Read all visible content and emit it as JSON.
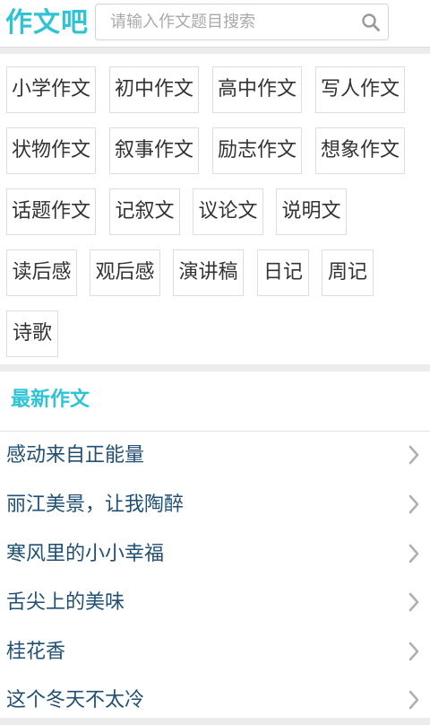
{
  "app": {
    "logo": "作文吧",
    "accent_color": "#2ec4d6"
  },
  "search": {
    "placeholder": "请输入作文题目搜索",
    "value": "",
    "icon": "search-icon"
  },
  "categories": [
    "小学作文",
    "初中作文",
    "高中作文",
    "写人作文",
    "状物作文",
    "叙事作文",
    "励志作文",
    "想象作文",
    "话题作文",
    "记叙文",
    "议论文",
    "说明文",
    "读后感",
    "观后感",
    "演讲稿",
    "日记",
    "周记",
    "诗歌"
  ],
  "latest": {
    "title": "最新作文",
    "articles": [
      "感动来自正能量",
      "丽江美景，让我陶醉",
      "寒风里的小小幸福",
      "舌尖上的美味",
      "桂花香",
      "这个冬天不太冷"
    ],
    "chevron_icon": "chevron-right-icon"
  }
}
